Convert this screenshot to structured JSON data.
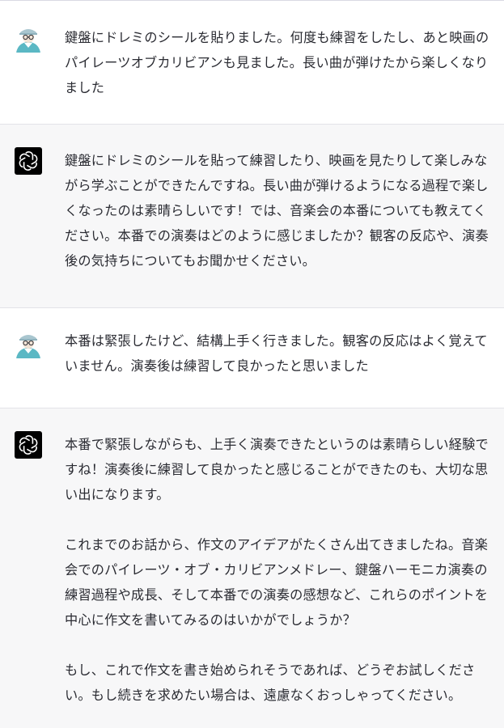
{
  "conversation": {
    "messages": [
      {
        "role": "user",
        "avatar_icon": "user-avatar-icon",
        "paragraphs": [
          "鍵盤にドレミのシールを貼りました。何度も練習をしたし、あと映画のパイレーツオブカリビアンも見ました。長い曲が弾けたから楽しくなりました"
        ]
      },
      {
        "role": "assistant",
        "avatar_icon": "openai-logo-icon",
        "paragraphs": [
          "鍵盤にドレミのシールを貼って練習したり、映画を見たりして楽しみながら学ぶことができたんですね。長い曲が弾けるようになる過程で楽しくなったのは素晴らしいです！では、音楽会の本番についても教えてください。本番での演奏はどのように感じましたか？観客の反応や、演奏後の気持ちについてもお聞かせください。"
        ]
      },
      {
        "role": "user",
        "avatar_icon": "user-avatar-icon",
        "paragraphs": [
          "本番は緊張したけど、結構上手く行きました。観客の反応はよく覚えていません。演奏後は練習して良かったと思いました"
        ]
      },
      {
        "role": "assistant",
        "avatar_icon": "openai-logo-icon",
        "paragraphs": [
          "本番で緊張しながらも、上手く演奏できたというのは素晴らしい経験ですね！演奏後に練習して良かったと感じることができたのも、大切な思い出になります。",
          "これまでのお話から、作文のアイデアがたくさん出てきましたね。音楽会でのパイレーツ・オブ・カリビアンメドレー、鍵盤ハーモニカ演奏の練習過程や成長、そして本番での演奏の感想など、これらのポイントを中心に作文を書いてみるのはいかがでしょうか？",
          "もし、これで作文を書き始められそうであれば、どうぞお試しください。もし続きを求めたい場合は、遠慮なくおっしゃってください。"
        ]
      }
    ]
  },
  "colors": {
    "user_bg": "#ffffff",
    "assistant_bg": "#f7f7f8",
    "text": "#2a2b32",
    "separator": "#e3e3e8",
    "avatar_teal": "#5bb8c4"
  }
}
